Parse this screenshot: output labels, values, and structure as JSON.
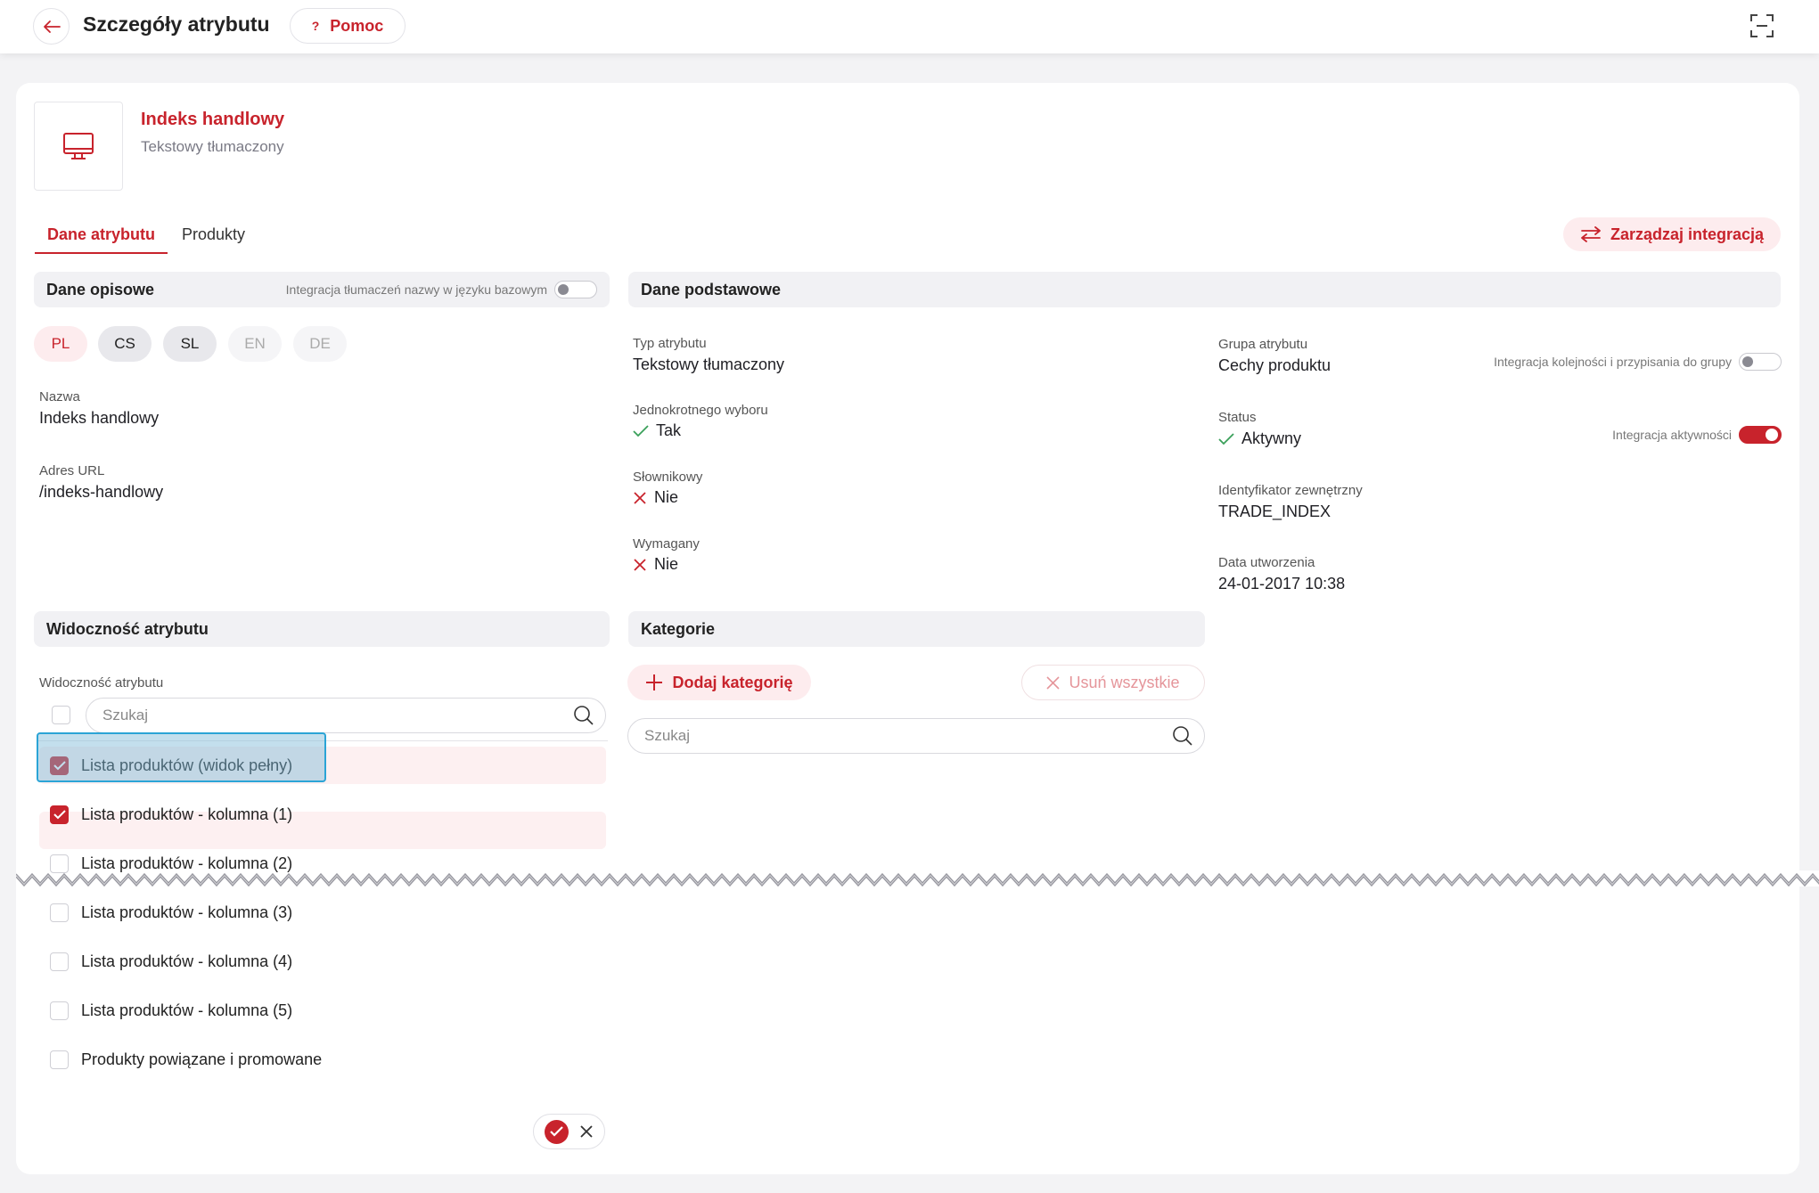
{
  "header": {
    "title": "Szczegóły atrybutu",
    "help_label": "Pomoc"
  },
  "attribute": {
    "name": "Indeks handlowy",
    "type": "Tekstowy tłumaczony"
  },
  "tabs": [
    {
      "label": "Dane atrybutu",
      "active": true
    },
    {
      "label": "Produkty",
      "active": false
    }
  ],
  "manage_integration_label": "Zarządzaj integracją",
  "descriptive": {
    "title": "Dane opisowe",
    "toggle_label": "Integracja tłumaczeń nazwy w języku bazowym",
    "languages": [
      "PL",
      "CS",
      "SL",
      "EN",
      "DE"
    ],
    "name_label": "Nazwa",
    "name_value": "Indeks handlowy",
    "url_label": "Adres URL",
    "url_value": "/indeks-handlowy"
  },
  "basic": {
    "title": "Dane podstawowe",
    "type_label": "Typ atrybutu",
    "type_value": "Tekstowy tłumaczony",
    "single_label": "Jednokrotnego wyboru",
    "single_value": "Tak",
    "dict_label": "Słownikowy",
    "dict_value": "Nie",
    "required_label": "Wymagany",
    "required_value": "Nie",
    "group_label": "Grupa atrybutu",
    "group_value": "Cechy produktu",
    "group_toggle_label": "Integracja kolejności i przypisania do grupy",
    "status_label": "Status",
    "status_value": "Aktywny",
    "activity_toggle_label": "Integracja aktywności",
    "ext_id_label": "Identyfikator zewnętrzny",
    "ext_id_value": "TRADE_INDEX",
    "created_label": "Data utworzenia",
    "created_value": "24-01-2017 10:38"
  },
  "visibility": {
    "title": "Widoczność atrybutu",
    "field_label": "Widoczność atrybutu",
    "search_placeholder": "Szukaj",
    "items": [
      {
        "label": "Lista produktów (widok pełny)",
        "checked": true
      },
      {
        "label": "Lista produktów - kolumna (1)",
        "checked": true
      },
      {
        "label": "Lista produktów - kolumna (2)",
        "checked": false
      },
      {
        "label": "Lista produktów - kolumna (3)",
        "checked": false
      },
      {
        "label": "Lista produktów - kolumna (4)",
        "checked": false
      },
      {
        "label": "Lista produktów - kolumna (5)",
        "checked": false
      },
      {
        "label": "Produkty powiązane i promowane",
        "checked": false
      }
    ]
  },
  "categories": {
    "title": "Kategorie",
    "add_label": "Dodaj kategorię",
    "remove_all_label": "Usuń wszystkie",
    "search_placeholder": "Szukaj"
  },
  "colors": {
    "accent": "#c8232c",
    "accent_light": "#fdecee",
    "focus": "#2ba4d6"
  }
}
